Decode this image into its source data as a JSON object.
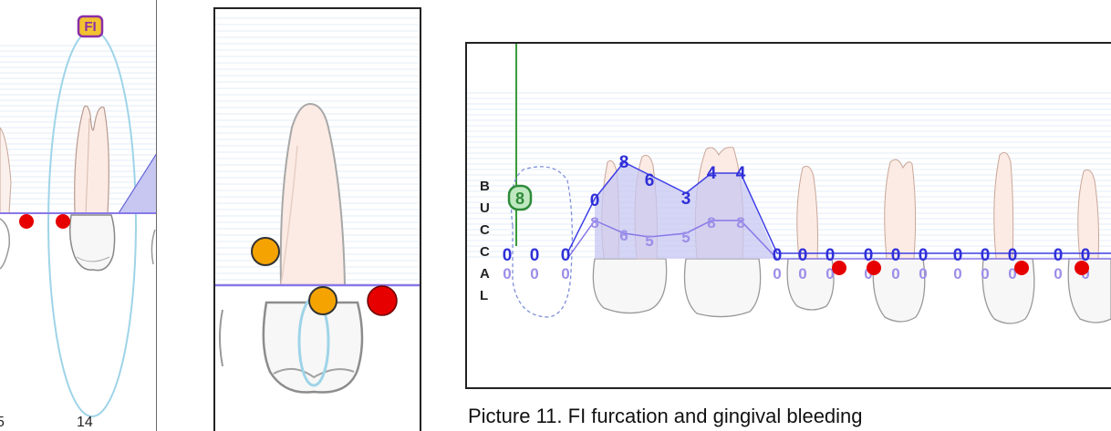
{
  "caption": "Picture 11. FI furcation and gingival bleeding",
  "panel_left": {
    "furcation_badge": "FI",
    "tooth_number": "14",
    "edge_number": "5"
  },
  "panel_right": {
    "side_letters": [
      "B",
      "U",
      "C",
      "C",
      "A",
      "L"
    ],
    "cal_badge": "8",
    "pocket_depths": [
      "0",
      "0",
      "0",
      "0",
      "8",
      "6",
      "3",
      "4",
      "4",
      "0",
      "0",
      "0",
      "0",
      "0",
      "0",
      "0",
      "0",
      "0",
      "0",
      "0"
    ],
    "recession_values": [
      "0",
      "0",
      "0",
      "8",
      "6",
      "5",
      "5",
      "8",
      "8",
      "0",
      "0",
      "0",
      "0",
      "0",
      "0",
      "0",
      "0",
      "0",
      "0",
      "0"
    ]
  },
  "colors": {
    "bleeding": "#e60000",
    "plaque": "#f5a300",
    "measurement": "#3d3ee6",
    "gingival_line": "#8878e8",
    "cal_green": "#2e8b3a",
    "furcation_badge": "#8a2fa8",
    "grid": "#e3eef7"
  }
}
